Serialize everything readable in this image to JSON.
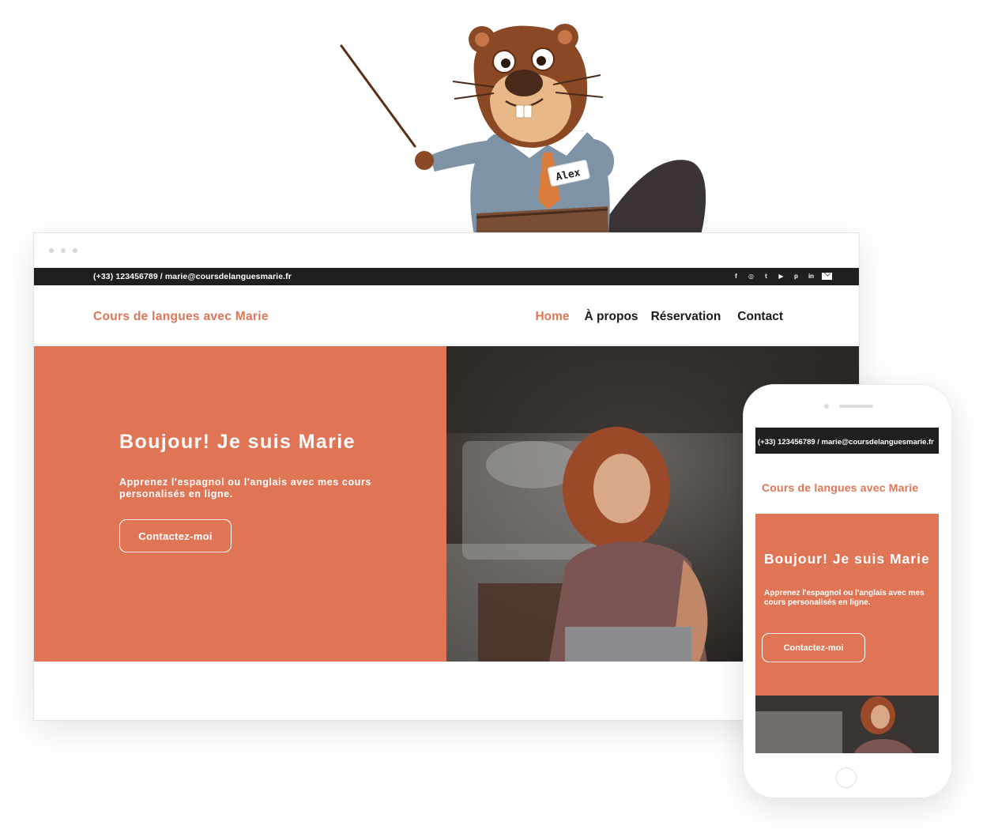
{
  "mascot": {
    "name_tag": "Alex"
  },
  "site": {
    "topbar_contact": "(+33) 123456789 / marie@coursdelanguesmarie.fr",
    "social_icons": [
      "facebook-icon",
      "instagram-icon",
      "twitter-icon",
      "youtube-icon",
      "pinterest-icon",
      "linkedin-icon",
      "mail-icon"
    ],
    "social_glyphs": {
      "facebook": "f",
      "instagram": "◎",
      "twitter": "t",
      "youtube": "▶",
      "pinterest": "p",
      "linkedin": "in"
    },
    "brand": "Cours de langues avec Marie",
    "menu": [
      {
        "label": "Home",
        "active": true
      },
      {
        "label": "À propos",
        "active": false
      },
      {
        "label": "Réservation",
        "active": false
      },
      {
        "label": "Contact",
        "active": false
      }
    ],
    "hero": {
      "title": "Boujour! Je suis Marie",
      "subtitle": "Apprenez l'espagnol ou l'anglais avec mes cours personalisés en ligne.",
      "cta": "Contactez-moi"
    }
  },
  "colors": {
    "accent": "#e07556",
    "topbar": "#1f1f1f",
    "text": "#1a1a1a"
  }
}
